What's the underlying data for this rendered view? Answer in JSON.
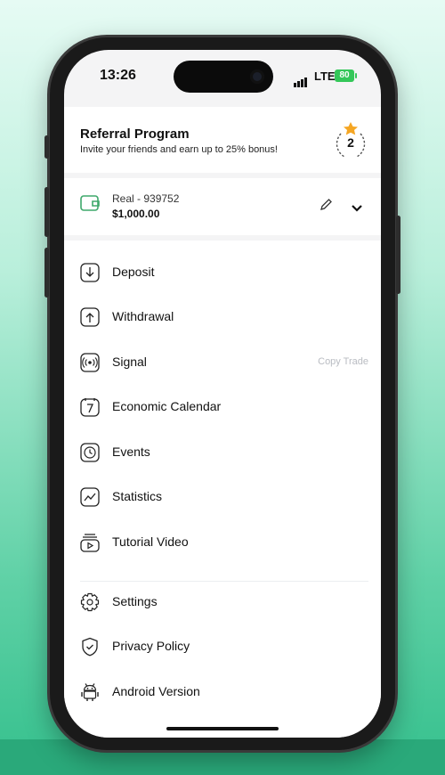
{
  "status_bar": {
    "time": "13:26",
    "network": "LTE",
    "battery": "80"
  },
  "referral": {
    "title": "Referral Program",
    "subtitle": "Invite your friends and earn up to 25% bonus!",
    "level": "2"
  },
  "account": {
    "name": "Real - 939752",
    "balance": "$1,000.00"
  },
  "menu": {
    "items": [
      {
        "label": "Deposit",
        "icon": "deposit-icon"
      },
      {
        "label": "Withdrawal",
        "icon": "withdrawal-icon"
      },
      {
        "label": "Signal",
        "icon": "signal-icon",
        "tag": "Copy Trade"
      },
      {
        "label": "Economic Calendar",
        "icon": "calendar-icon"
      },
      {
        "label": "Events",
        "icon": "events-icon"
      },
      {
        "label": "Statistics",
        "icon": "statistics-icon"
      },
      {
        "label": "Tutorial Video",
        "icon": "tutorial-video-icon"
      }
    ],
    "secondary": [
      {
        "label": "Settings",
        "icon": "settings-icon"
      },
      {
        "label": "Privacy Policy",
        "icon": "privacy-icon"
      },
      {
        "label": "Android Version",
        "icon": "android-icon"
      }
    ]
  },
  "colors": {
    "accent": "#35c08d",
    "badge_star": "#f5a623",
    "wallet": "#3ea86b"
  }
}
